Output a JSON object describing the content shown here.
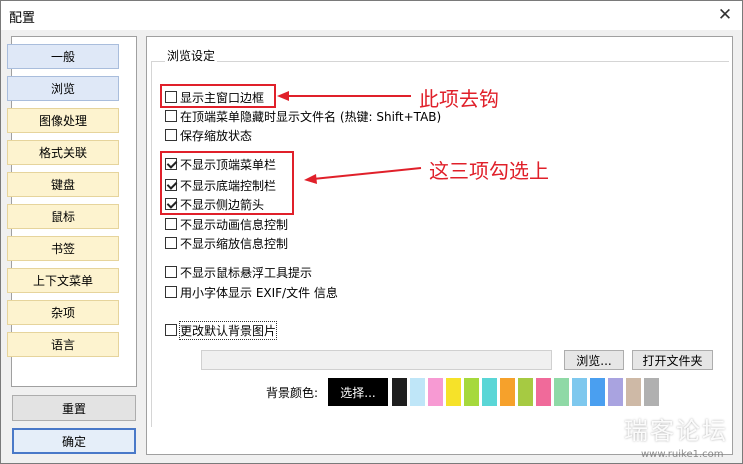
{
  "window": {
    "title": "配置"
  },
  "sidebar": {
    "items": [
      {
        "label": "一般",
        "active": true
      },
      {
        "label": "浏览",
        "active": true
      },
      {
        "label": "图像处理",
        "active": false
      },
      {
        "label": "格式关联",
        "active": false
      },
      {
        "label": "键盘",
        "active": false
      },
      {
        "label": "鼠标",
        "active": false
      },
      {
        "label": "书签",
        "active": false
      },
      {
        "label": "上下文菜单",
        "active": false
      },
      {
        "label": "杂项",
        "active": false
      },
      {
        "label": "语言",
        "active": false
      }
    ],
    "reset_label": "重置",
    "ok_label": "确定"
  },
  "browse": {
    "section_title": "浏览设定",
    "options": [
      {
        "label": "显示主窗口边框",
        "checked": false
      },
      {
        "label": "在顶端菜单隐藏时显示文件名 (热键: Shift+TAB)",
        "checked": false
      },
      {
        "label": "保存缩放状态",
        "checked": false
      },
      {
        "label": "不显示顶端菜单栏",
        "checked": true
      },
      {
        "label": "不显示底端控制栏",
        "checked": true
      },
      {
        "label": "不显示侧边箭头",
        "checked": true
      },
      {
        "label": "不显示动画信息控制",
        "checked": false
      },
      {
        "label": "不显示缩放信息控制",
        "checked": false
      },
      {
        "label": "不显示鼠标悬浮工具提示",
        "checked": false
      },
      {
        "label": "用小字体显示 EXIF/文件 信息",
        "checked": false
      },
      {
        "label": "更改默认背景图片",
        "checked": false
      }
    ],
    "background_path": "",
    "browse_button": "浏览...",
    "open_folder_button": "打开文件夹",
    "bg_color_label": "背景颜色:",
    "choose_button": "选择...",
    "swatches": [
      "#1e1e1e",
      "#bfe6f8",
      "#f79ad3",
      "#f6e229",
      "#a6d93c",
      "#5ad6d6",
      "#f6a12b",
      "#a6ca42",
      "#f06a9a",
      "#8fd9a6",
      "#7ec8ee",
      "#4a9ff0",
      "#a9a3e0",
      "#ceb9a6",
      "#b0b0b0"
    ]
  },
  "annotations": {
    "uncheck_note": "此项去钩",
    "check_note": "这三项勾选上"
  },
  "watermark": {
    "main": "瑞客论坛",
    "sub": "www.ruike1.com"
  }
}
